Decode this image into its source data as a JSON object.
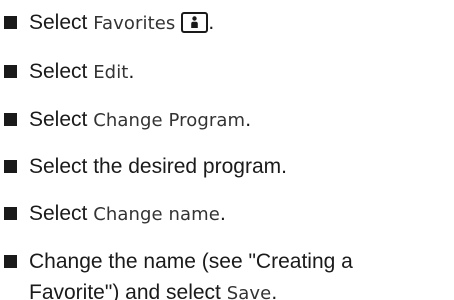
{
  "steps": [
    {
      "lead": "Select ",
      "ui": "Favorites",
      "tail": "."
    },
    {
      "lead": "Select ",
      "ui": "Edit",
      "tail": "."
    },
    {
      "lead": "Select ",
      "ui": "Change Program",
      "tail": "."
    },
    {
      "lead": "Select the desired program."
    },
    {
      "lead": "Select ",
      "ui": "Change name",
      "tail": "."
    },
    {
      "line1": "Change the name (see \"Creating a",
      "line2_lead": "Favorite\") and select ",
      "ui": "Save",
      "tail": "."
    }
  ],
  "icons": {
    "favorites": "person-favorites-icon",
    "bullet": "square-bullet"
  },
  "colors": {
    "text": "#1a1a1a",
    "display_text": "#333333",
    "background": "#ffffff"
  }
}
